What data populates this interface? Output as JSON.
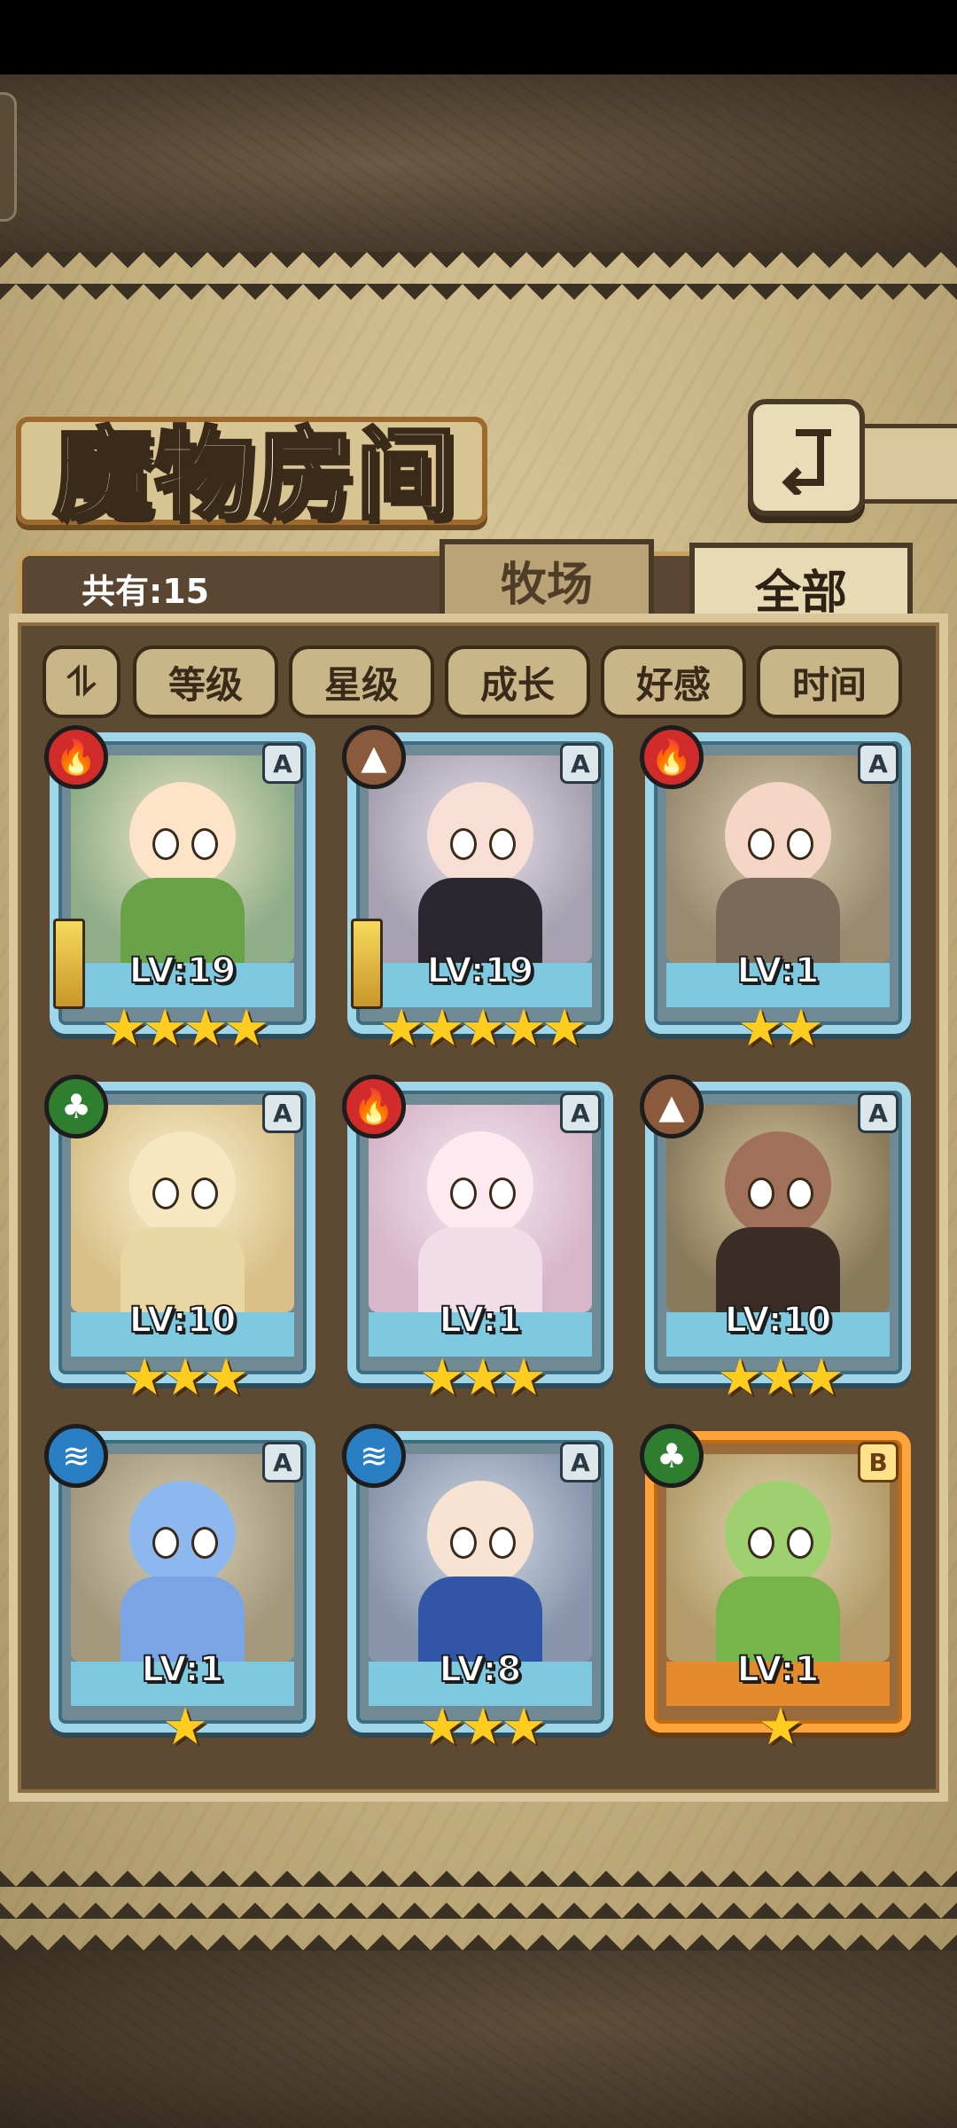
{
  "header": {
    "title": "魔物房间"
  },
  "tabs": {
    "count_label": "共有:15",
    "ranch": "牧场",
    "all": "全部"
  },
  "sort": {
    "toggle_label": "⥮",
    "buttons": [
      "等级",
      "星级",
      "成长",
      "好感",
      "时间"
    ]
  },
  "cards": [
    {
      "level": "LV:19",
      "stars": "★★★★",
      "grade": "A",
      "element": "fire-icon",
      "weapon": true,
      "rare": false,
      "colors": [
        "#f3e7c8",
        "#8fae88",
        "#fde3c8",
        "#6aa24a"
      ]
    },
    {
      "level": "LV:19",
      "stars": "★★★★★",
      "grade": "A",
      "element": "earth-icon",
      "weapon": true,
      "rare": false,
      "colors": [
        "#e9e3ea",
        "#a7a0b0",
        "#f8dfd5",
        "#2b2630"
      ]
    },
    {
      "level": "LV:1",
      "stars": "★★",
      "grade": "A",
      "element": "fire-icon",
      "weapon": false,
      "rare": false,
      "colors": [
        "#d9cdb0",
        "#9a8a70",
        "#f5d6c6",
        "#7a6a5a"
      ]
    },
    {
      "level": "LV:10",
      "stars": "★★★",
      "grade": "A",
      "element": "grass-icon",
      "weapon": false,
      "rare": false,
      "colors": [
        "#fff4d6",
        "#d8c088",
        "#f7e7c1",
        "#e9d7a3"
      ]
    },
    {
      "level": "LV:1",
      "stars": "★★★",
      "grade": "A",
      "element": "fire-icon",
      "weapon": false,
      "rare": false,
      "colors": [
        "#f5eaf2",
        "#d7b6c9",
        "#fde9ef",
        "#f2dce8"
      ]
    },
    {
      "level": "LV:10",
      "stars": "★★★",
      "grade": "A",
      "element": "earth-icon",
      "weapon": false,
      "rare": false,
      "colors": [
        "#d9c8a0",
        "#8a7a5c",
        "#a0705a",
        "#3a2d26"
      ]
    },
    {
      "level": "LV:1",
      "stars": "★",
      "grade": "A",
      "element": "water-icon",
      "weapon": false,
      "rare": false,
      "colors": [
        "#d9d0b8",
        "#a3987c",
        "#8db7ef",
        "#7aa4e6"
      ]
    },
    {
      "level": "LV:8",
      "stars": "★★★",
      "grade": "A",
      "element": "water-icon",
      "weapon": false,
      "rare": false,
      "colors": [
        "#d4dbe6",
        "#8895ac",
        "#f8e3d3",
        "#3156a8"
      ]
    },
    {
      "level": "LV:1",
      "stars": "★",
      "grade": "B",
      "element": "grass-icon",
      "weapon": false,
      "rare": true,
      "colors": [
        "#e5d8b4",
        "#b39c6a",
        "#9ed06f",
        "#77b44a"
      ]
    }
  ]
}
